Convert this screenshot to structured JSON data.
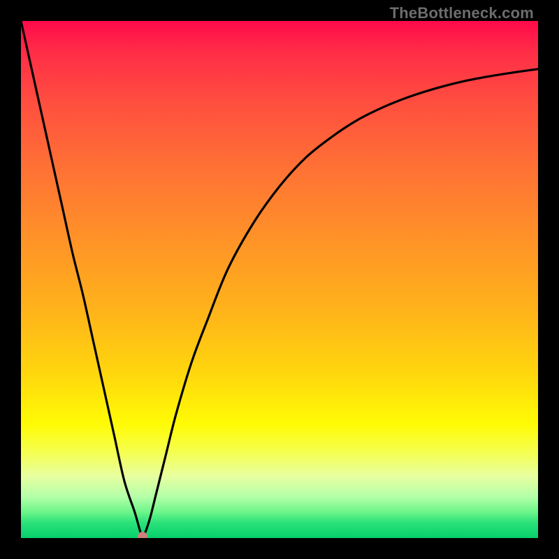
{
  "watermark": "TheBottleneck.com",
  "colors": {
    "frame_bg": "#000000",
    "curve": "#000000",
    "marker": "#cf7f7f"
  },
  "chart_data": {
    "type": "line",
    "title": "",
    "xlabel": "",
    "ylabel": "",
    "xlim": [
      0,
      100
    ],
    "ylim": [
      0,
      100
    ],
    "grid": false,
    "legend": false,
    "series": [
      {
        "name": "bottleneck-curve",
        "x": [
          0,
          2,
          4,
          6,
          8,
          10,
          12,
          14,
          16,
          18,
          20,
          22,
          23,
          23.5,
          24,
          25,
          26,
          28,
          30,
          33,
          36,
          40,
          45,
          50,
          55,
          60,
          65,
          70,
          75,
          80,
          85,
          90,
          95,
          100
        ],
        "values": [
          100,
          91,
          82,
          73,
          64,
          55,
          47,
          38,
          29,
          20,
          11,
          5,
          1.5,
          0.3,
          1,
          4,
          8,
          16,
          24,
          34,
          42,
          52,
          61,
          68,
          73.5,
          77.5,
          80.8,
          83.3,
          85.3,
          86.9,
          88.2,
          89.2,
          90,
          90.7
        ]
      }
    ],
    "marker": {
      "x": 23.5,
      "y": 0.3
    },
    "notes": "Values are estimated from pixel positions; y=0 is bottom (green), y=100 is top (red)."
  }
}
